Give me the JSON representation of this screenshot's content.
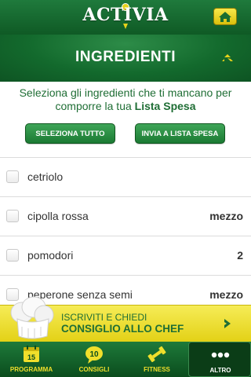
{
  "header": {
    "logo_text": "ACTIVIA",
    "home_icon": "home-icon"
  },
  "section": {
    "title": "INGREDIENTI",
    "collapse_icon": "chevron-up-double-icon"
  },
  "intro": {
    "text_before": "Seleziona gli ingredienti che ti mancano per comporre la tua ",
    "text_bold": "Lista Spesa"
  },
  "actions": {
    "select_all": "SELEZIONA TUTTO",
    "send_to_list": "INVIA A LISTA SPESA"
  },
  "ingredients": [
    {
      "name": "cetriolo",
      "qty": ""
    },
    {
      "name": "cipolla rossa",
      "qty": "mezzo"
    },
    {
      "name": "pomodori",
      "qty": "2"
    },
    {
      "name": "peperone senza semi",
      "qty": "mezzo"
    }
  ],
  "promo": {
    "line1": "ISCRIVITI E CHIEDI",
    "line2": "CONSIGLIO ALLO CHEF"
  },
  "tabs": [
    {
      "label": "PROGRAMMA",
      "icon": "calendar-icon",
      "badge": "15"
    },
    {
      "label": "CONSIGLI",
      "icon": "tips-icon",
      "badge": "10"
    },
    {
      "label": "FITNESS",
      "icon": "dumbbell-icon"
    },
    {
      "label": "ALTRO",
      "icon": "more-icon"
    }
  ],
  "colors": {
    "brand_green": "#136a2d",
    "accent_yellow": "#f0df2b",
    "text_green": "#1f6e35"
  }
}
